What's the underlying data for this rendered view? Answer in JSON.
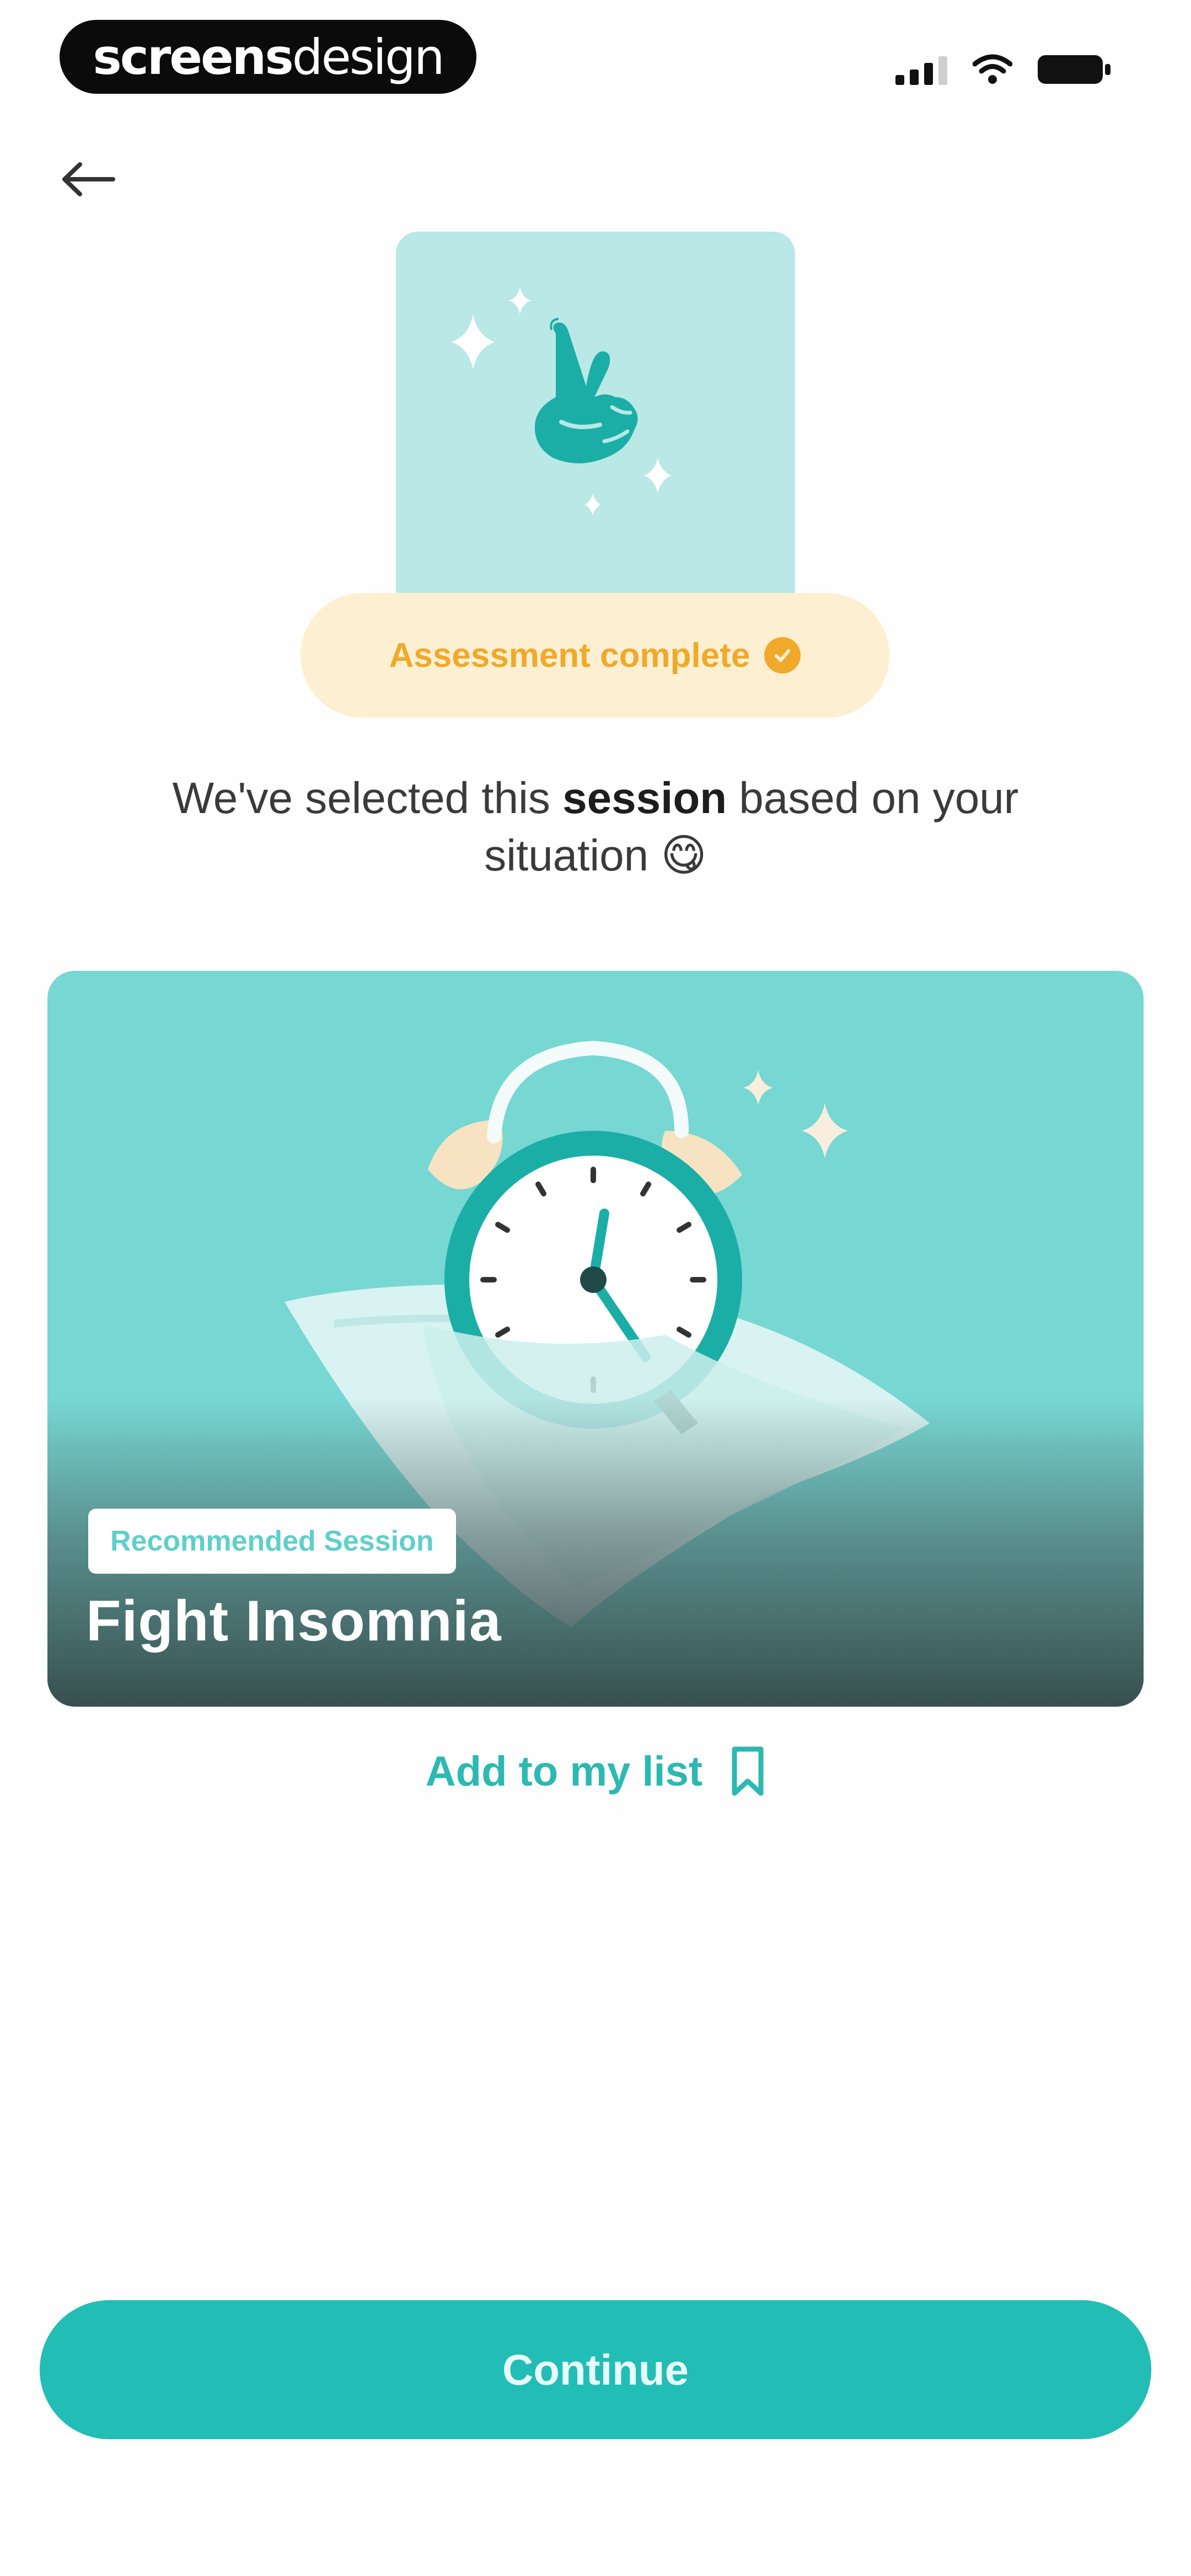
{
  "status_bar": {
    "brand_bold": "screens",
    "brand_light": "design",
    "signal_icon": "cellular-signal-icon",
    "wifi_icon": "wifi-icon",
    "battery_icon": "battery-icon"
  },
  "nav": {
    "back_icon": "arrow-left-icon"
  },
  "hero": {
    "illustration": "victory-hand-sparkles-illustration",
    "badge_label": "Assessment complete",
    "badge_icon": "check-circle-icon"
  },
  "intro": {
    "text_before": "We've selected this ",
    "text_bold": "session",
    "text_after": " based on your situation ",
    "emoji": "😋"
  },
  "session_card": {
    "illustration": "alarm-clock-on-pillow-illustration",
    "tag": "Recommended Session",
    "title": "Fight Insomnia"
  },
  "add_to_list": {
    "label": "Add to my list",
    "icon": "bookmark-icon"
  },
  "continue_button": {
    "label": "Continue"
  },
  "colors": {
    "primary": "#22bdb5",
    "card_bg": "#76d7d3",
    "hero_bg": "#b9e8e6",
    "badge_bg": "#fdf0d2",
    "badge_text": "#f0a92a"
  }
}
